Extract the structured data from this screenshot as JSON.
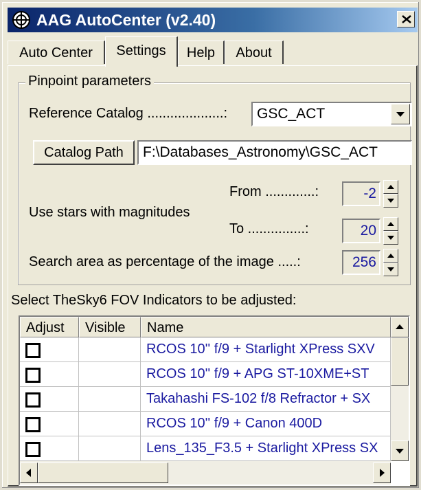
{
  "window": {
    "title": "AAG AutoCenter (v2.40)",
    "close_glyph": "×"
  },
  "tabs": [
    {
      "label": "Auto Center",
      "active": false
    },
    {
      "label": "Settings",
      "active": true
    },
    {
      "label": "Help",
      "active": false
    },
    {
      "label": "About",
      "active": false
    }
  ],
  "pinpoint": {
    "group_label": "Pinpoint parameters",
    "reference_catalog_label": "Reference Catalog ....................:",
    "reference_catalog_value": "GSC_ACT",
    "catalog_path_button": "Catalog Path",
    "catalog_path_value": "F:\\Databases_Astronomy\\GSC_ACT",
    "use_stars_label": "Use stars with magnitudes",
    "from_label": "From .............:",
    "from_value": "-2",
    "to_label": "To ...............:",
    "to_value": "20",
    "search_area_label": "Search area as percentage of the image .....:",
    "search_area_value": "256"
  },
  "fov": {
    "section_label": "Select TheSky6 FOV Indicators to be adjusted:",
    "columns": [
      "Adjust",
      "Visible",
      "Name"
    ],
    "rows": [
      {
        "adjust": false,
        "visible": "",
        "name": "RCOS 10'' f/9 + Starlight XPress SXV"
      },
      {
        "adjust": false,
        "visible": "",
        "name": "RCOS 10'' f/9 + APG ST-10XME+ST"
      },
      {
        "adjust": false,
        "visible": "",
        "name": "Takahashi FS-102 f/8 Refractor + SX"
      },
      {
        "adjust": false,
        "visible": "",
        "name": "RCOS 10'' f/9 + Canon 400D"
      },
      {
        "adjust": false,
        "visible": "",
        "name": "Lens_135_F3.5 + Starlight XPress SX"
      }
    ]
  },
  "colors": {
    "title_start": "#0a246a",
    "title_end": "#a6caf0",
    "value_text": "#1a1aa0",
    "face": "#ece9d8"
  }
}
